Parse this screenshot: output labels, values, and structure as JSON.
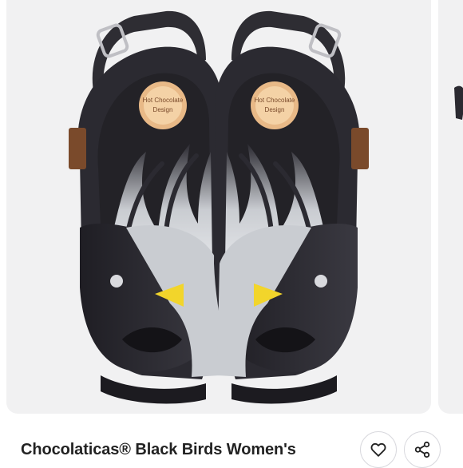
{
  "product": {
    "title": "Chocolaticas® Black Birds Women's",
    "brand_logo_text": "Hot Chocolate Design"
  },
  "actions": {
    "like_icon": "heart-icon",
    "share_icon": "share-icon"
  },
  "colors": {
    "accent_black": "#2b2a31",
    "wing_gray": "#c9ccd1",
    "beak_yellow": "#f2d52b",
    "logo_tan": "#e8b987",
    "tag_brown": "#7a4a2b",
    "background": "#f1f1f2"
  }
}
